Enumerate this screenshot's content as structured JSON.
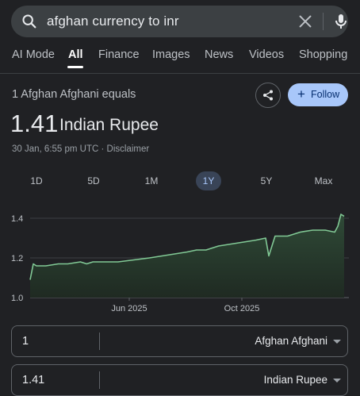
{
  "search": {
    "query": "afghan currency to inr"
  },
  "tabs": [
    {
      "label": "AI Mode"
    },
    {
      "label": "All"
    },
    {
      "label": "Finance"
    },
    {
      "label": "Images"
    },
    {
      "label": "News"
    },
    {
      "label": "Videos"
    },
    {
      "label": "Shopping"
    }
  ],
  "active_tab": "All",
  "conversion": {
    "equals_label": "1 Afghan Afghani equals",
    "rate": "1.41",
    "target_currency": "Indian Rupee",
    "timestamp": "30 Jan, 6:55 pm UTC · Disclaimer",
    "follow_label": "Follow"
  },
  "ranges": [
    {
      "label": "1D"
    },
    {
      "label": "5D"
    },
    {
      "label": "1M"
    },
    {
      "label": "1Y"
    },
    {
      "label": "5Y"
    },
    {
      "label": "Max"
    }
  ],
  "active_range": "1Y",
  "chart_data": {
    "type": "line",
    "ylim": [
      1.0,
      1.4
    ],
    "yticks": [
      "1.4",
      "1.2",
      "1.0"
    ],
    "xticks": [
      "Jun 2025",
      "Oct 2025"
    ],
    "x": [
      0,
      0.01,
      0.02,
      0.05,
      0.09,
      0.12,
      0.16,
      0.18,
      0.2,
      0.24,
      0.28,
      0.33,
      0.38,
      0.42,
      0.46,
      0.5,
      0.53,
      0.56,
      0.6,
      0.64,
      0.68,
      0.72,
      0.75,
      0.76,
      0.78,
      0.82,
      0.86,
      0.9,
      0.94,
      0.97,
      0.98,
      0.99,
      1.0
    ],
    "values": [
      1.09,
      1.17,
      1.16,
      1.16,
      1.17,
      1.17,
      1.18,
      1.17,
      1.18,
      1.18,
      1.18,
      1.19,
      1.2,
      1.21,
      1.22,
      1.23,
      1.24,
      1.24,
      1.26,
      1.27,
      1.28,
      1.29,
      1.3,
      1.21,
      1.31,
      1.31,
      1.33,
      1.34,
      1.34,
      1.33,
      1.36,
      1.42,
      1.41
    ],
    "colors": {
      "line": "#81c995",
      "fill_top": "#2f4a37",
      "grid": "#3c4043"
    }
  },
  "converter": {
    "from_amount": "1",
    "from_currency": "Afghan Afghani",
    "to_amount": "1.41",
    "to_currency": "Indian Rupee"
  },
  "colors": {
    "background": "#202124",
    "accent": "#a8c7fa"
  }
}
